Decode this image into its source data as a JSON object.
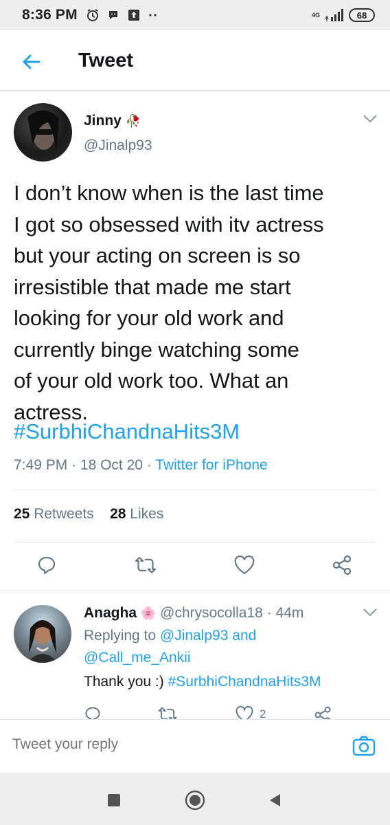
{
  "status_bar": {
    "time": "8:36 PM",
    "network": "4G",
    "battery": "68"
  },
  "header": {
    "title": "Tweet",
    "back_icon": "arrow-left-icon"
  },
  "tweet": {
    "author_name": "Jinny",
    "author_emoji": "🥀",
    "author_handle": "@Jinalp93",
    "text_lines": [
      "I don’t know when is the last time",
      "I got so obsessed with itv actress",
      "but your acting on screen is so",
      "irresistible that made me start",
      "looking for your old work and",
      "currently binge watching some",
      "of your old work too. What an",
      "actress."
    ],
    "hashtag": "#SurbhiChandnaHits3M",
    "time": "7:49 PM",
    "date": "18 Oct 20",
    "separator": "·",
    "source": "Twitter for iPhone",
    "retweets_count": "25",
    "retweets_label": "Retweets",
    "likes_count": "28",
    "likes_label": "Likes"
  },
  "reply": {
    "name": "Anagha",
    "emoji": "🌸",
    "handle": "@chrysocolla18",
    "separator": "·",
    "age": "44m",
    "replying_to_prefix": "Replying to",
    "replying_to_1": "@Jinalp93",
    "replying_and": "and",
    "replying_to_2": "@Call_me_Ankii",
    "text": "Thank you :)",
    "hashtag": "#SurbhiChandnaHits3M",
    "likes": "2"
  },
  "compose": {
    "placeholder": "Tweet your reply"
  },
  "colors": {
    "accent": "#1da1f2",
    "secondary_text": "#657786",
    "primary_text": "#14171a",
    "divider": "#e1e8ed"
  }
}
